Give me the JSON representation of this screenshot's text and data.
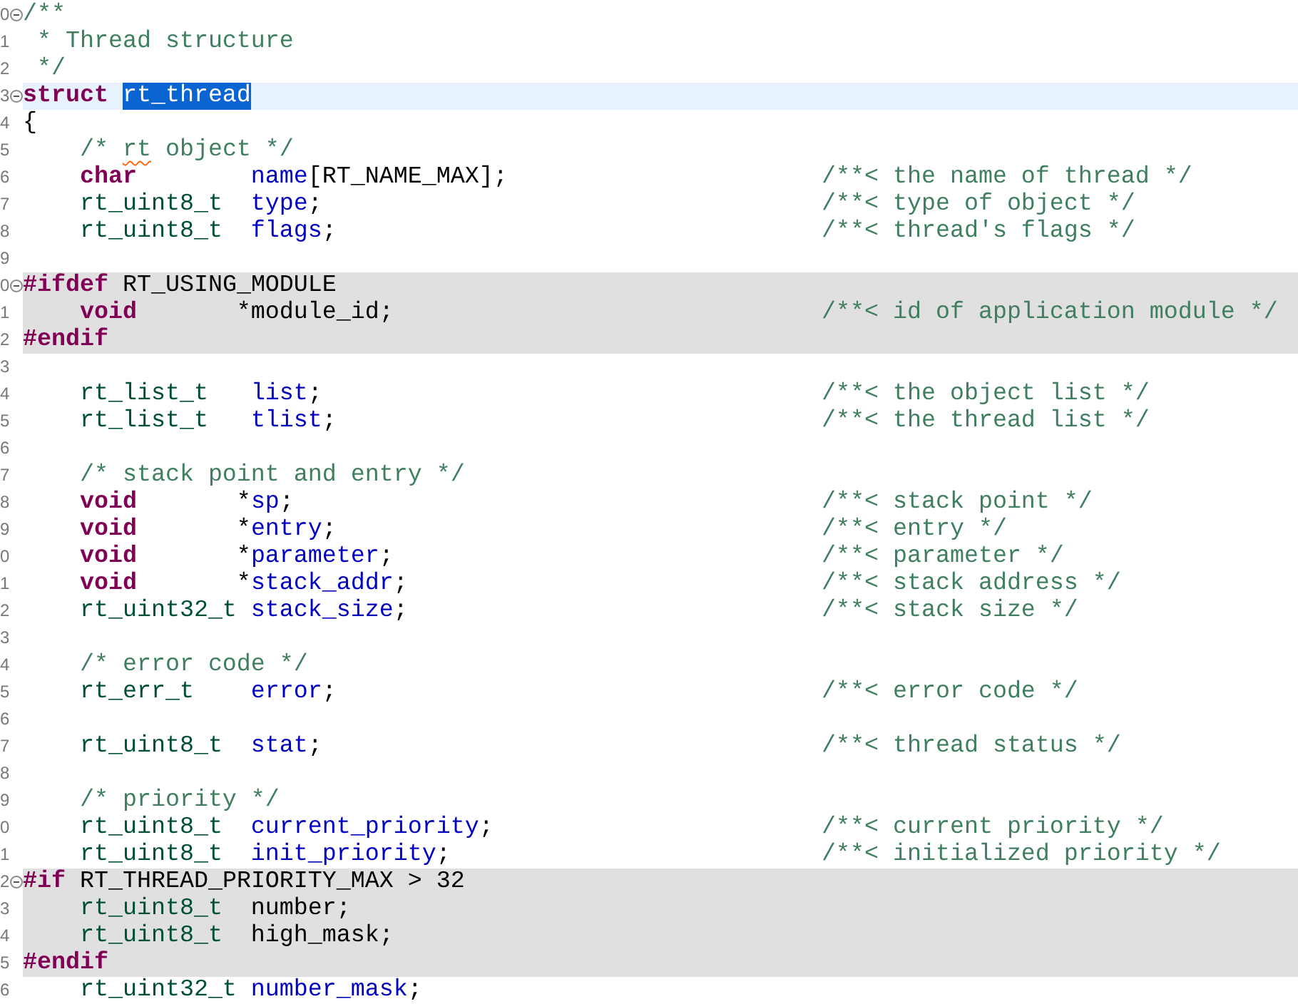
{
  "editor": {
    "lines": [
      {
        "number": "0",
        "fold": true,
        "shaded": false,
        "current": false,
        "tokens": [
          {
            "kind": "comment",
            "text": "/**"
          }
        ]
      },
      {
        "number": "1",
        "fold": false,
        "shaded": false,
        "current": false,
        "tokens": [
          {
            "kind": "comment",
            "text": " * Thread structure"
          }
        ]
      },
      {
        "number": "2",
        "fold": false,
        "shaded": false,
        "current": false,
        "tokens": [
          {
            "kind": "comment",
            "text": " */"
          }
        ]
      },
      {
        "number": "3",
        "fold": true,
        "shaded": false,
        "current": true,
        "tokens": [
          {
            "kind": "keyword",
            "text": "struct"
          },
          {
            "kind": "plain",
            "text": "rt_thread",
            "selected": true
          }
        ]
      },
      {
        "number": "4",
        "fold": false,
        "shaded": false,
        "current": false,
        "tokens": [
          {
            "kind": "plain",
            "text": "{"
          }
        ]
      },
      {
        "number": "5",
        "fold": false,
        "shaded": false,
        "current": false,
        "tokens": [
          {
            "kind": "comment",
            "text": "    /* "
          },
          {
            "kind": "comment",
            "text": "rt",
            "misspelled": true
          },
          {
            "kind": "comment",
            "text": " object */"
          }
        ]
      },
      {
        "number": "6",
        "fold": false,
        "shaded": false,
        "current": false,
        "tokens": [
          {
            "kind": "keyword",
            "text": "    char"
          },
          {
            "kind": "field",
            "text": "        name"
          },
          {
            "kind": "plain",
            "text": "[RT_NAME_MAX];"
          }
        ],
        "comment": "/**< the name of thread */"
      },
      {
        "number": "7",
        "fold": false,
        "shaded": false,
        "current": false,
        "tokens": [
          {
            "kind": "type",
            "text": "    rt_uint8_t"
          },
          {
            "kind": "field",
            "text": "  type"
          },
          {
            "kind": "plain",
            "text": ";"
          }
        ],
        "comment": "/**< type of object */"
      },
      {
        "number": "8",
        "fold": false,
        "shaded": false,
        "current": false,
        "tokens": [
          {
            "kind": "type",
            "text": "    rt_uint8_t"
          },
          {
            "kind": "field",
            "text": "  flags"
          },
          {
            "kind": "plain",
            "text": ";"
          }
        ],
        "comment": "/**< thread's flags */"
      },
      {
        "number": "9",
        "fold": false,
        "shaded": false,
        "current": false
      },
      {
        "number": "0",
        "fold": true,
        "shaded": true,
        "current": false,
        "tokens": [
          {
            "kind": "preproc",
            "text": "#ifdef"
          },
          {
            "kind": "plain",
            "text": " RT_USING_MODULE"
          }
        ]
      },
      {
        "number": "1",
        "fold": false,
        "shaded": true,
        "current": false,
        "tokens": [
          {
            "kind": "keyword",
            "text": "    void"
          },
          {
            "kind": "plain",
            "text": "       *module_id;"
          }
        ],
        "comment": "/**< id of application module */"
      },
      {
        "number": "2",
        "fold": false,
        "shaded": true,
        "current": false,
        "tokens": [
          {
            "kind": "preproc",
            "text": "#endif"
          }
        ]
      },
      {
        "number": "3",
        "fold": false,
        "shaded": false,
        "current": false
      },
      {
        "number": "4",
        "fold": false,
        "shaded": false,
        "current": false,
        "tokens": [
          {
            "kind": "type",
            "text": "    rt_list_t"
          },
          {
            "kind": "field",
            "text": "   list"
          },
          {
            "kind": "plain",
            "text": ";"
          }
        ],
        "comment": "/**< the object list */"
      },
      {
        "number": "5",
        "fold": false,
        "shaded": false,
        "current": false,
        "tokens": [
          {
            "kind": "type",
            "text": "    rt_list_t"
          },
          {
            "kind": "field",
            "text": "   tlist"
          },
          {
            "kind": "plain",
            "text": ";"
          }
        ],
        "comment": "/**< the thread list */"
      },
      {
        "number": "6",
        "fold": false,
        "shaded": false,
        "current": false
      },
      {
        "number": "7",
        "fold": false,
        "shaded": false,
        "current": false,
        "tokens": [
          {
            "kind": "comment",
            "text": "    /* stack point and entry */"
          }
        ]
      },
      {
        "number": "8",
        "fold": false,
        "shaded": false,
        "current": false,
        "tokens": [
          {
            "kind": "keyword",
            "text": "    void"
          },
          {
            "kind": "plain",
            "text": "       *"
          },
          {
            "kind": "field",
            "text": "sp"
          },
          {
            "kind": "plain",
            "text": ";"
          }
        ],
        "comment": "/**< stack point */"
      },
      {
        "number": "9",
        "fold": false,
        "shaded": false,
        "current": false,
        "tokens": [
          {
            "kind": "keyword",
            "text": "    void"
          },
          {
            "kind": "plain",
            "text": "       *"
          },
          {
            "kind": "field",
            "text": "entry"
          },
          {
            "kind": "plain",
            "text": ";"
          }
        ],
        "comment": "/**< entry */"
      },
      {
        "number": "0",
        "fold": false,
        "shaded": false,
        "current": false,
        "tokens": [
          {
            "kind": "keyword",
            "text": "    void"
          },
          {
            "kind": "plain",
            "text": "       *"
          },
          {
            "kind": "field",
            "text": "parameter"
          },
          {
            "kind": "plain",
            "text": ";"
          }
        ],
        "comment": "/**< parameter */"
      },
      {
        "number": "1",
        "fold": false,
        "shaded": false,
        "current": false,
        "tokens": [
          {
            "kind": "keyword",
            "text": "    void"
          },
          {
            "kind": "plain",
            "text": "       *"
          },
          {
            "kind": "field",
            "text": "stack_addr"
          },
          {
            "kind": "plain",
            "text": ";"
          }
        ],
        "comment": "/**< stack address */"
      },
      {
        "number": "2",
        "fold": false,
        "shaded": false,
        "current": false,
        "tokens": [
          {
            "kind": "type",
            "text": "    rt_uint32_t"
          },
          {
            "kind": "field",
            "text": " stack_size"
          },
          {
            "kind": "plain",
            "text": ";"
          }
        ],
        "comment": "/**< stack size */"
      },
      {
        "number": "3",
        "fold": false,
        "shaded": false,
        "current": false
      },
      {
        "number": "4",
        "fold": false,
        "shaded": false,
        "current": false,
        "tokens": [
          {
            "kind": "comment",
            "text": "    /* error code */"
          }
        ]
      },
      {
        "number": "5",
        "fold": false,
        "shaded": false,
        "current": false,
        "tokens": [
          {
            "kind": "type",
            "text": "    rt_err_t"
          },
          {
            "kind": "field",
            "text": "    error"
          },
          {
            "kind": "plain",
            "text": ";"
          }
        ],
        "comment": "/**< error code */"
      },
      {
        "number": "6",
        "fold": false,
        "shaded": false,
        "current": false
      },
      {
        "number": "7",
        "fold": false,
        "shaded": false,
        "current": false,
        "tokens": [
          {
            "kind": "type",
            "text": "    rt_uint8_t"
          },
          {
            "kind": "field",
            "text": "  stat"
          },
          {
            "kind": "plain",
            "text": ";"
          }
        ],
        "comment": "/**< thread status */"
      },
      {
        "number": "8",
        "fold": false,
        "shaded": false,
        "current": false
      },
      {
        "number": "9",
        "fold": false,
        "shaded": false,
        "current": false,
        "tokens": [
          {
            "kind": "comment",
            "text": "    /* priority */"
          }
        ]
      },
      {
        "number": "0",
        "fold": false,
        "shaded": false,
        "current": false,
        "tokens": [
          {
            "kind": "type",
            "text": "    rt_uint8_t"
          },
          {
            "kind": "field",
            "text": "  current_priority"
          },
          {
            "kind": "plain",
            "text": ";"
          }
        ],
        "comment": "/**< current priority */"
      },
      {
        "number": "1",
        "fold": false,
        "shaded": false,
        "current": false,
        "tokens": [
          {
            "kind": "type",
            "text": "    rt_uint8_t"
          },
          {
            "kind": "field",
            "text": "  init_priority"
          },
          {
            "kind": "plain",
            "text": ";"
          }
        ],
        "comment": "/**< initialized priority */"
      },
      {
        "number": "2",
        "fold": true,
        "shaded": true,
        "current": false,
        "tokens": [
          {
            "kind": "preproc",
            "text": "#if"
          },
          {
            "kind": "plain",
            "text": " RT_THREAD_PRIORITY_MAX > 32"
          }
        ]
      },
      {
        "number": "3",
        "fold": false,
        "shaded": true,
        "current": false,
        "tokens": [
          {
            "kind": "type",
            "text": "    rt_uint8_t"
          },
          {
            "kind": "plain",
            "text": "  number;"
          }
        ]
      },
      {
        "number": "4",
        "fold": false,
        "shaded": true,
        "current": false,
        "tokens": [
          {
            "kind": "type",
            "text": "    rt_uint8_t"
          },
          {
            "kind": "plain",
            "text": "  high_mask;"
          }
        ]
      },
      {
        "number": "5",
        "fold": false,
        "shaded": true,
        "current": false,
        "tokens": [
          {
            "kind": "preproc",
            "text": "#endif"
          }
        ]
      },
      {
        "number": "6",
        "fold": false,
        "shaded": false,
        "current": false,
        "tokens": [
          {
            "kind": "type",
            "text": "    rt_uint32_t"
          },
          {
            "kind": "field",
            "text": " number_mask"
          },
          {
            "kind": "plain",
            "text": ";"
          }
        ]
      }
    ]
  }
}
